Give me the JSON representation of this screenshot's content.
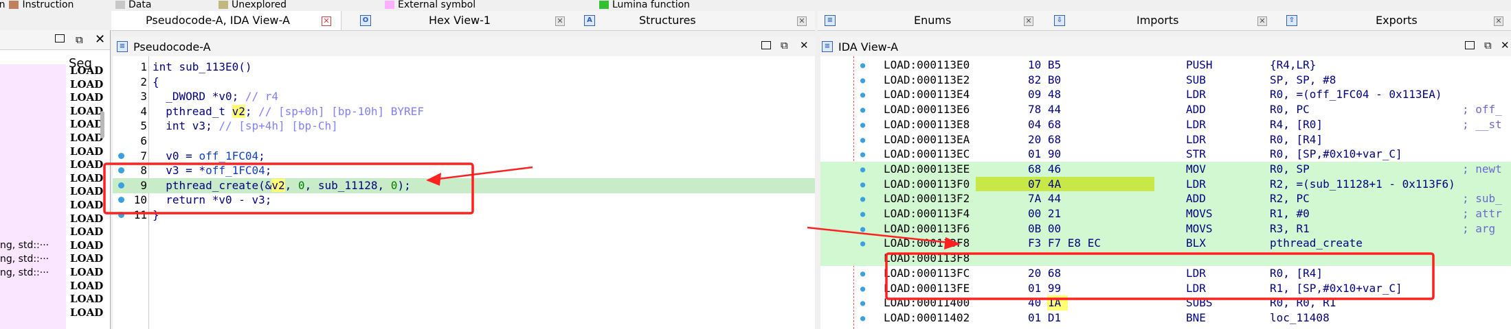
{
  "legend": [
    {
      "label": "on Instruction",
      "color": "#c08060"
    },
    {
      "label": "Data",
      "color": "#c8c8c8"
    },
    {
      "label": "Unexplored",
      "color": "#c0b880"
    },
    {
      "label": "External symbol",
      "color": "#ffb0ff"
    },
    {
      "label": "Lumina function",
      "color": "#30c030"
    }
  ],
  "left": {
    "column_header": "Seg",
    "rows": [
      "LOAD",
      "LOAD",
      "LOAD",
      "LOAD",
      "LOAD",
      "LOAD",
      "LOAD",
      "LOAD",
      "LOAD",
      "LOAD",
      "LOAD",
      "LOAD",
      "LOAD",
      "LOAD",
      "LOAD",
      "LOAD",
      "LOAD",
      "LOAD",
      "LOAD"
    ],
    "left_texts": [
      "ng, std::···",
      "ng, std::···",
      "ng, std::···"
    ]
  },
  "tabs_left": [
    "Pseudocode-A, IDA View-A",
    "Hex View-1",
    "Structures"
  ],
  "tabs_right": [
    "Enums",
    "Imports",
    "Exports"
  ],
  "pseudo_title": "Pseudocode-A",
  "ida_title": "IDA View-A",
  "pseudocode": [
    {
      "n": "1",
      "dot": false,
      "hl": false,
      "parts": [
        [
          "int sub_113E0()",
          "kw"
        ]
      ]
    },
    {
      "n": "2",
      "dot": false,
      "hl": false,
      "parts": [
        [
          "{",
          "kw"
        ]
      ]
    },
    {
      "n": "3",
      "dot": false,
      "hl": false,
      "parts": [
        [
          "  _DWORD *v0; ",
          "kw"
        ],
        [
          "// r4",
          "cm"
        ]
      ]
    },
    {
      "n": "4",
      "dot": false,
      "hl": false,
      "parts": [
        [
          "  pthread_t ",
          "kw"
        ],
        [
          "v2",
          "yl"
        ],
        [
          "; ",
          "kw"
        ],
        [
          "// [sp+0h] [bp-10h] BYREF",
          "cm"
        ]
      ]
    },
    {
      "n": "5",
      "dot": false,
      "hl": false,
      "parts": [
        [
          "  int v3; ",
          "kw"
        ],
        [
          "// [sp+4h] [bp-Ch]",
          "cm"
        ]
      ]
    },
    {
      "n": "6",
      "dot": false,
      "hl": false,
      "parts": [
        [
          "",
          "kw"
        ]
      ]
    },
    {
      "n": "7",
      "dot": true,
      "hl": false,
      "parts": [
        [
          "  v0 = ",
          "kw"
        ],
        [
          "off_1FC04",
          "gv"
        ],
        [
          ";",
          "kw"
        ]
      ]
    },
    {
      "n": "8",
      "dot": true,
      "hl": false,
      "parts": [
        [
          "  v3 = *",
          "kw"
        ],
        [
          "off_1FC04",
          "gv"
        ],
        [
          ";",
          "kw"
        ]
      ]
    },
    {
      "n": "9",
      "dot": true,
      "hl": true,
      "parts": [
        [
          "  pthread_create(&",
          "kw"
        ],
        [
          "v2",
          "yl"
        ],
        [
          ", ",
          "kw"
        ],
        [
          "0",
          "num"
        ],
        [
          ", sub_11128, ",
          "kw"
        ],
        [
          "0",
          "num"
        ],
        [
          ");",
          "kw"
        ]
      ]
    },
    {
      "n": "10",
      "dot": true,
      "hl": false,
      "parts": [
        [
          "  return *v0 - v3;",
          "kw"
        ]
      ]
    },
    {
      "n": "11",
      "dot": true,
      "hl": false,
      "parts": [
        [
          "}",
          "kw"
        ]
      ]
    }
  ],
  "ida_rows": [
    {
      "addr": "LOAD:000113E0",
      "bytes": "10 B5",
      "mn": "PUSH",
      "op": "{R4,LR}",
      "cm": "",
      "g": false
    },
    {
      "addr": "LOAD:000113E2",
      "bytes": "82 B0",
      "mn": "SUB",
      "op": "SP, SP, #8",
      "cm": "",
      "g": false
    },
    {
      "addr": "LOAD:000113E4",
      "bytes": "09 48",
      "mn": "LDR",
      "op": "R0, =(off_1FC04 - 0x113EA)",
      "cm": "",
      "g": false
    },
    {
      "addr": "LOAD:000113E6",
      "bytes": "78 44",
      "mn": "ADD",
      "op": "R0, PC",
      "cm": "; off_",
      "g": false
    },
    {
      "addr": "LOAD:000113E8",
      "bytes": "04 68",
      "mn": "LDR",
      "op": "R4, [R0]",
      "cm": "; __st",
      "g": false
    },
    {
      "addr": "LOAD:000113EA",
      "bytes": "20 68",
      "mn": "LDR",
      "op": "R0, [R4]",
      "cm": "",
      "g": false
    },
    {
      "addr": "LOAD:000113EC",
      "bytes": "01 90",
      "mn": "STR",
      "op": "R0, [SP,#0x10+var_C]",
      "cm": "",
      "g": false
    },
    {
      "addr": "LOAD:000113EE",
      "bytes": "68 46",
      "mn": "MOV",
      "op": "R0, SP",
      "cm": "; newt",
      "g": true
    },
    {
      "addr": "LOAD:000113F0",
      "bytes": "07 4A",
      "mn": "LDR",
      "op": "R2, =(sub_11128+1 - 0x113F6)",
      "cm": "",
      "g": true
    },
    {
      "addr": "LOAD:000113F2",
      "bytes": "7A 44",
      "mn": "ADD",
      "op": "R2, PC",
      "cm": "; sub_",
      "g": true
    },
    {
      "addr": "LOAD:000113F4",
      "bytes": "00 21",
      "mn": "MOVS",
      "op": "R1, #0",
      "cm": "; attr",
      "g": true
    },
    {
      "addr": "LOAD:000113F6",
      "bytes": "0B 00",
      "mn": "MOVS",
      "op": "R3, R1",
      "cm": "; arg",
      "g": true
    },
    {
      "addr": "LOAD:000113F8",
      "bytes": "F3 F7 E8 EC",
      "mn": "BLX",
      "op": "pthread_create",
      "cm": "",
      "g": true
    },
    {
      "addr": "LOAD:000113F8",
      "bytes": "",
      "mn": "",
      "op": "",
      "cm": "",
      "g": true
    },
    {
      "addr": "LOAD:000113FC",
      "bytes": "20 68",
      "mn": "LDR",
      "op": "R0, [R4]",
      "cm": "",
      "g": false
    },
    {
      "addr": "LOAD:000113FE",
      "bytes": "01 99",
      "mn": "LDR",
      "op": "R1, [SP,#0x10+var_C]",
      "cm": "",
      "g": false
    },
    {
      "addr": "LOAD:00011400",
      "bytes": "40 1A",
      "mn": "SUBS",
      "op": "R0, R0, R1",
      "cm": "",
      "g": false
    },
    {
      "addr": "LOAD:00011402",
      "bytes": "01 D1",
      "mn": "BNE",
      "op": "loc_11408",
      "cm": "",
      "g": false
    }
  ],
  "colors": {
    "highlight": "#c8ecc8",
    "ida_green": "#d2f8d2",
    "annotation": "#ff2020",
    "yellow": "#ffff70"
  }
}
